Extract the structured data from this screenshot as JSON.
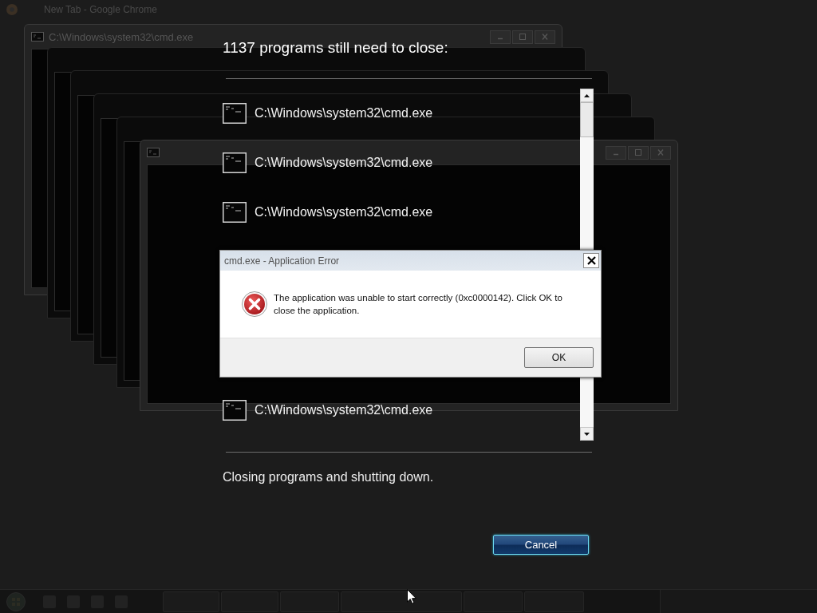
{
  "browser": {
    "title": "New Tab - Google Chrome"
  },
  "console_windows": [
    {
      "kind": "titled",
      "title": "C:\\Windows\\system32\\cmd.exe"
    },
    {
      "kind": "plain"
    },
    {
      "kind": "plain"
    },
    {
      "kind": "plain"
    },
    {
      "kind": "plain"
    },
    {
      "kind": "framed"
    }
  ],
  "shutdown": {
    "heading": "1137 programs still need to close:",
    "programs": [
      {
        "name": "C:\\Windows\\system32\\cmd.exe"
      },
      {
        "name": "C:\\Windows\\system32\\cmd.exe"
      },
      {
        "name": "C:\\Windows\\system32\\cmd.exe"
      },
      {
        "name": "C:\\Windows\\system32\\cmd.exe"
      }
    ],
    "status": "Closing programs and shutting down.",
    "cancel_button": "Cancel"
  },
  "error_dialog": {
    "title": "cmd.exe - Application Error",
    "message": "The application was unable to start correctly (0xc0000142). Click OK to close the application.",
    "ok_button": "OK"
  }
}
